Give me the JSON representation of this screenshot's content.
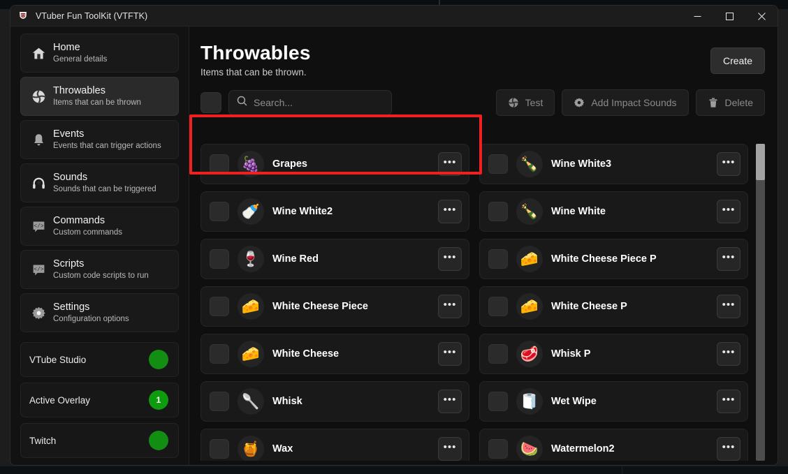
{
  "window": {
    "title": "VTuber Fun ToolKit (VTFTK)",
    "app_icon": "vtftk-logo-icon",
    "controls": {
      "minimize": "—",
      "maximize": "☐",
      "close": "✕"
    }
  },
  "sidebar": {
    "items": [
      {
        "title": "Home",
        "subtitle": "General details",
        "icon": "home-icon",
        "active": false
      },
      {
        "title": "Throwables",
        "subtitle": "Items that can be thrown",
        "icon": "ball-icon",
        "active": true
      },
      {
        "title": "Events",
        "subtitle": "Events that can trigger actions",
        "icon": "bell-icon",
        "active": false
      },
      {
        "title": "Sounds",
        "subtitle": "Sounds that can be triggered",
        "icon": "headphones-icon",
        "active": false
      },
      {
        "title": "Commands",
        "subtitle": "Custom commands",
        "icon": "code-bubble-icon",
        "active": false
      },
      {
        "title": "Scripts",
        "subtitle": "Custom code scripts to run",
        "icon": "code-bubble-icon",
        "active": false
      },
      {
        "title": "Settings",
        "subtitle": "Configuration options",
        "icon": "gear-icon",
        "active": false
      }
    ],
    "status": [
      {
        "label": "VTube Studio",
        "badge": "",
        "color": "#128e12"
      },
      {
        "label": "Active Overlay",
        "badge": "1",
        "color": "#0e9c0e"
      },
      {
        "label": "Twitch",
        "badge": "",
        "color": "#128e12"
      }
    ]
  },
  "main": {
    "title": "Throwables",
    "subtitle": "Items that can be thrown.",
    "create_label": "Create",
    "search_placeholder": "Search...",
    "search_value": "",
    "buttons": [
      {
        "label": "Test",
        "icon": "ball-icon"
      },
      {
        "label": "Add Impact Sounds",
        "icon": "gear-icon"
      },
      {
        "label": "Delete",
        "icon": "trash-icon"
      }
    ],
    "items": [
      {
        "name": "Grapes",
        "icon": "🍇"
      },
      {
        "name": "Wine White3",
        "icon": "🍾"
      },
      {
        "name": "Wine White2",
        "icon": "🍼"
      },
      {
        "name": "Wine White",
        "icon": "🍾"
      },
      {
        "name": "Wine Red",
        "icon": "🍷"
      },
      {
        "name": "White Cheese Piece P",
        "icon": "🧀"
      },
      {
        "name": "White Cheese Piece",
        "icon": "🧀"
      },
      {
        "name": "White Cheese P",
        "icon": "🧀"
      },
      {
        "name": "White Cheese",
        "icon": "🧀"
      },
      {
        "name": "Whisk P",
        "icon": "🥩"
      },
      {
        "name": "Whisk",
        "icon": "🥄"
      },
      {
        "name": "Wet Wipe",
        "icon": "🧻"
      },
      {
        "name": "Wax",
        "icon": "🍯"
      },
      {
        "name": "Watermelon2",
        "icon": "🍉"
      }
    ],
    "row_menu_glyph": "•••"
  },
  "annotation": {
    "color": "#ee2020",
    "target": "Grapes"
  }
}
